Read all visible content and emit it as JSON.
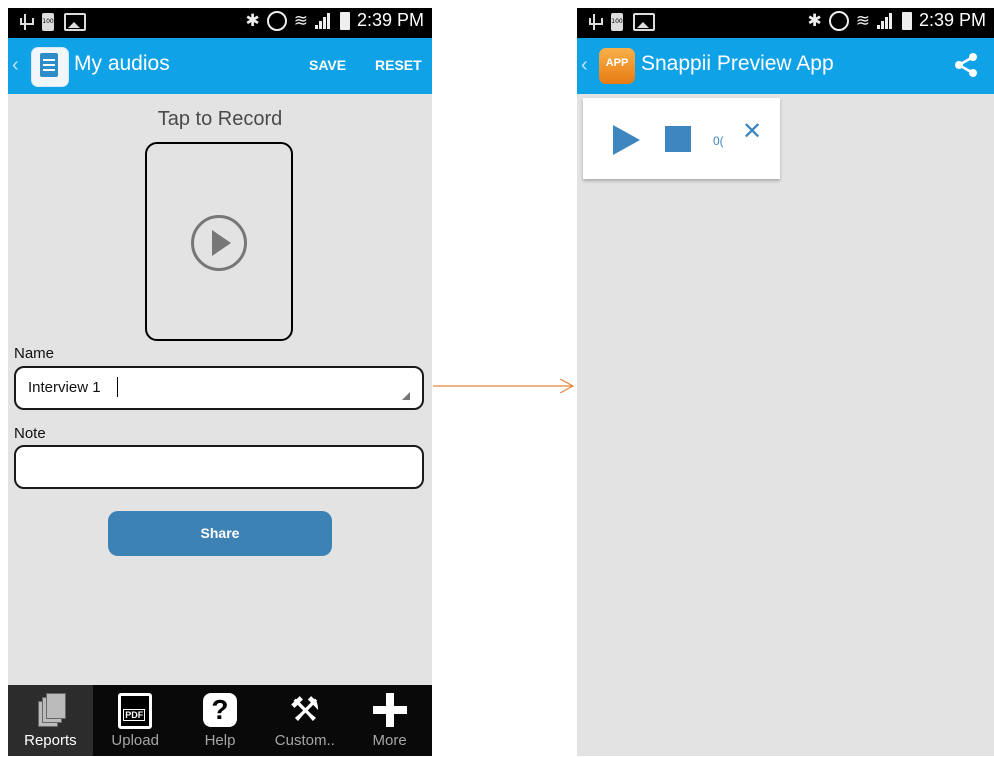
{
  "status_bar": {
    "time": "2:39 PM",
    "battery_text": "100"
  },
  "left": {
    "app_title": "My audios",
    "save_label": "SAVE",
    "reset_label": "RESET",
    "tap_to_record": "Tap to Record",
    "name_label": "Name",
    "name_value": "Interview 1",
    "note_label": "Note",
    "note_value": "",
    "share_label": "Share",
    "tabs": [
      {
        "label": "Reports",
        "icon": "reports-icon",
        "active": true
      },
      {
        "label": "Upload",
        "icon": "pdf-icon",
        "active": false
      },
      {
        "label": "Help",
        "icon": "help-icon",
        "active": false
      },
      {
        "label": "Custom..",
        "icon": "tools-icon",
        "active": false
      },
      {
        "label": "More",
        "icon": "plus-icon",
        "active": false
      }
    ]
  },
  "right": {
    "app_title": "Snappii Preview App",
    "logo_text": "APP",
    "player_time": "0("
  },
  "colors": {
    "app_bar": "#0fa2e7",
    "share_button": "#3d82b5",
    "player_accent": "#3e86c0",
    "connector": "#e8863a"
  }
}
